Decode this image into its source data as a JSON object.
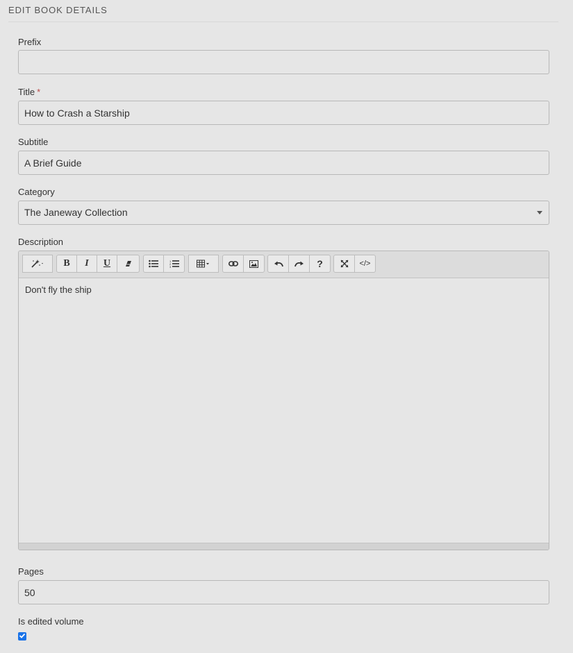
{
  "header": {
    "title": "EDIT BOOK DETAILS"
  },
  "form": {
    "prefix": {
      "label": "Prefix",
      "value": ""
    },
    "title": {
      "label": "Title",
      "required_mark": "*",
      "value": "How to Crash a Starship"
    },
    "subtitle": {
      "label": "Subtitle",
      "value": "A Brief Guide"
    },
    "category": {
      "label": "Category",
      "value": "The Janeway Collection"
    },
    "description": {
      "label": "Description",
      "content": "Don't fly the ship",
      "toolbar": [
        "magic-icon",
        "bold-icon",
        "italic-icon",
        "underline-icon",
        "eraser-icon",
        "unordered-list-icon",
        "ordered-list-icon",
        "table-icon",
        "link-icon",
        "picture-icon",
        "undo-icon",
        "redo-icon",
        "help-icon",
        "fullscreen-icon",
        "code-view-icon"
      ]
    },
    "pages": {
      "label": "Pages",
      "value": "50"
    },
    "is_edited_volume": {
      "label": "Is edited volume",
      "checked": true
    }
  }
}
